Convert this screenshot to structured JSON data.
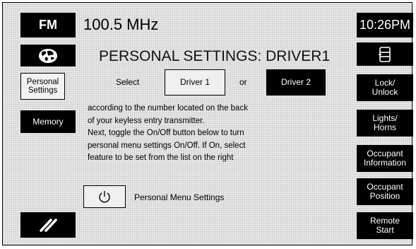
{
  "left_panel": {
    "band_label": "FM",
    "personal_settings_label_line1": "Personal",
    "personal_settings_label_line2": "Settings",
    "memory_label": "Memory"
  },
  "header": {
    "frequency": "100.5 MHz",
    "clock": "10:26PM"
  },
  "main": {
    "title": "PERSONAL SETTINGS: DRIVER1",
    "select_label": "Select",
    "driver1_label": "Driver 1",
    "or_label": "or",
    "driver2_label": "Driver 2",
    "instructions": [
      "according to the number located on the back",
      "of your keyless entry transmitter.",
      "Next, toggle the On/Off button below to turn",
      "personal menu settings On/Off. If On, select",
      "feature to be set from the list on the right"
    ],
    "personal_menu_settings_label": "Personal Menu Settings"
  },
  "right_panel": {
    "lock_unlock_line1": "Lock/",
    "lock_unlock_line2": "Unlock",
    "lights_horns_line1": "Lights/",
    "lights_horns_line2": "Horns",
    "occupant_information_line1": "Occupant",
    "occupant_information_line2": "Information",
    "occupant_position_line1": "Occupant",
    "occupant_position_line2": "Position",
    "remote_start_line1": "Remote",
    "remote_start_line2": "Start"
  },
  "colors": {
    "button_bg": "#000000",
    "button_text": "#ffffff",
    "screen_bg": "#e9e9e9"
  },
  "icons": {
    "nav": "globe-icon",
    "settings": "phone-settings-icon",
    "power": "power-icon",
    "diagonal": "diagonal-lines-icon"
  }
}
